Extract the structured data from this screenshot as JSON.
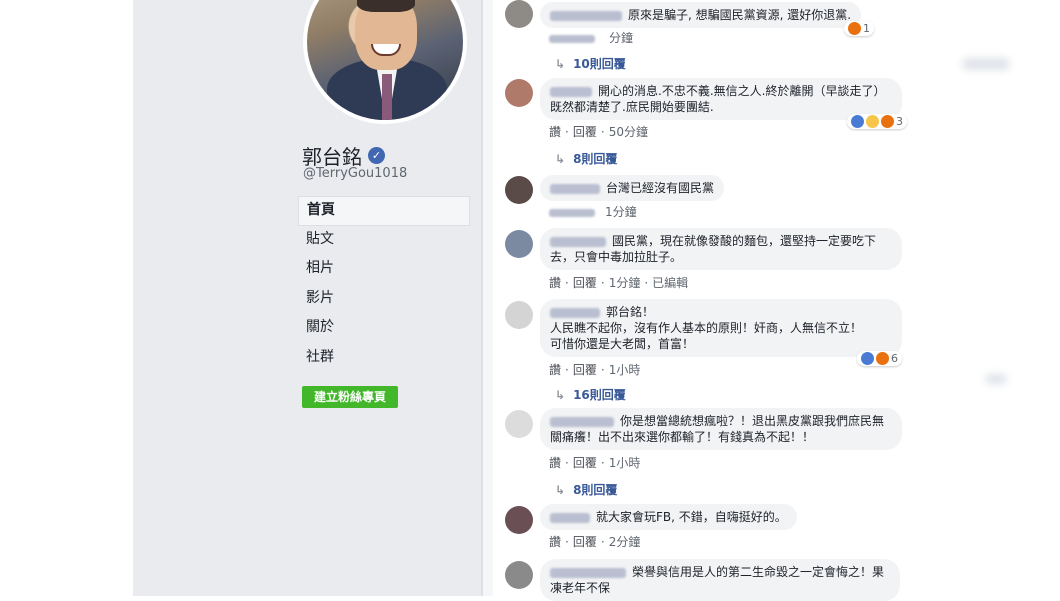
{
  "page": {
    "name": "郭台銘",
    "handle": "@TerryGou1018",
    "nav": [
      "首頁",
      "貼文",
      "相片",
      "影片",
      "關於",
      "社群"
    ],
    "create_page_label": "建立粉絲專頁"
  },
  "actions": {
    "like": "讚",
    "reply": "回覆",
    "edited": "已編輯"
  },
  "comments": [
    {
      "text": "原來是騙子, 想騙國民黨資源, 還好你退黨.",
      "time": "分鐘",
      "reaction_count": "1",
      "replies": "10則回覆"
    },
    {
      "text": "開心的消息.不忠不義.無信之人.終於離開（早談走了）既然都清楚了.庶民開始要團結.",
      "time": "50分鐘",
      "reaction_count": "3",
      "replies": "8則回覆"
    },
    {
      "text": "台灣已經沒有國民黨",
      "time": "1分鐘"
    },
    {
      "text": "國民黨，現在就像發酸的麵包，還堅持一定要吃下去，只會中毒加拉肚子。",
      "time": "1分鐘",
      "edited": true
    },
    {
      "text_lines": [
        "郭台銘！",
        "人民瞧不起你，沒有作人基本的原則！奸商，人無信不立！",
        "可惜你還是大老闆，首富！"
      ],
      "time": "1小時",
      "reaction_count": "6",
      "replies": "16則回覆"
    },
    {
      "text": "你是想當總統想瘋啦？！退出黑皮黨跟我們庶民無關痛癢！出不出來選你都輸了！有錢真為不起！！",
      "time": "1小時",
      "replies": "8則回覆"
    },
    {
      "text": "就大家會玩FB, 不錯，自嗨挺好的。",
      "time": "2分鐘"
    },
    {
      "text": "榮譽與信用是人的第二生命毀之一定會悔之！果凍老年不保"
    }
  ]
}
